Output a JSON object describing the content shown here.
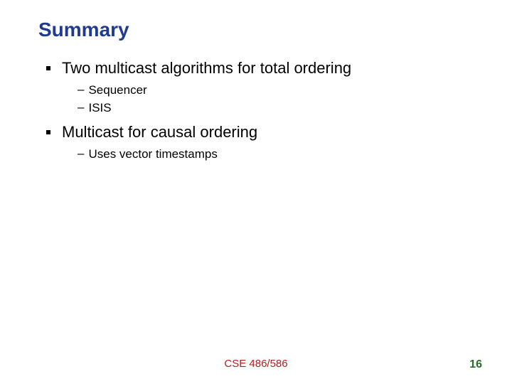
{
  "title": "Summary",
  "bullets": [
    {
      "text": "Two multicast algorithms for total ordering",
      "subs": [
        "Sequencer",
        "ISIS"
      ]
    },
    {
      "text": "Multicast for causal ordering",
      "subs": [
        "Uses vector timestamps"
      ]
    }
  ],
  "footer": {
    "center": "CSE 486/586",
    "page": "16"
  }
}
